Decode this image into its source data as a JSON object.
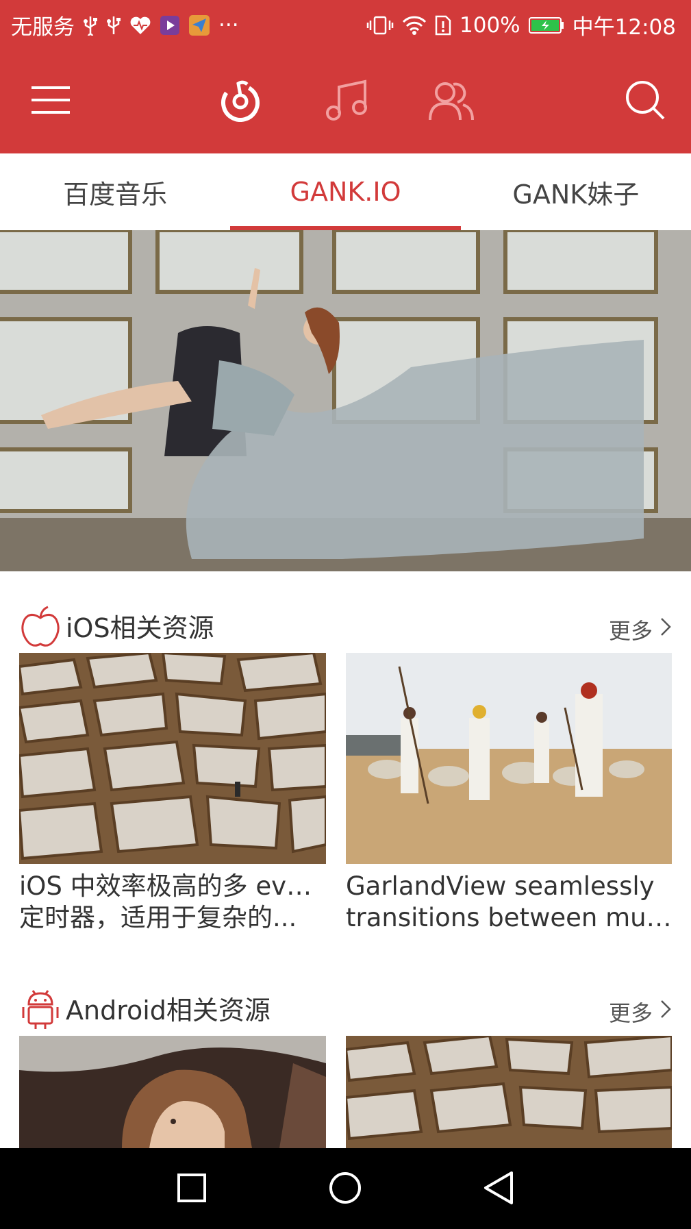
{
  "status_bar": {
    "carrier": "无服务",
    "more_indicator": "···",
    "battery": "100%",
    "time": "中午12:08"
  },
  "toolbar": {
    "icons": [
      "menu-icon",
      "netease-music-logo-icon",
      "music-note-icon",
      "friends-icon",
      "search-icon"
    ]
  },
  "tabs": [
    {
      "label": "百度音乐",
      "active": false
    },
    {
      "label": "GANK.IO",
      "active": true
    },
    {
      "label": "GANK妹子",
      "active": false
    }
  ],
  "sections": [
    {
      "title": "iOS相关资源",
      "icon": "apple-icon",
      "more_label": "更多",
      "items": [
        {
          "line1": "iOS 中效率极高的多 event",
          "line2": "定时器，适用于复杂的..."
        },
        {
          "line1": "GarlandView seamlessly",
          "line2": "transitions between multi..."
        }
      ]
    },
    {
      "title": "Android相关资源",
      "icon": "android-icon",
      "more_label": "更多",
      "items": [
        {
          "line1": "",
          "line2": ""
        },
        {
          "line1": "",
          "line2": ""
        }
      ]
    }
  ],
  "colors": {
    "accent": "#d23a3a",
    "text": "#333333",
    "navbar": "#000000"
  }
}
